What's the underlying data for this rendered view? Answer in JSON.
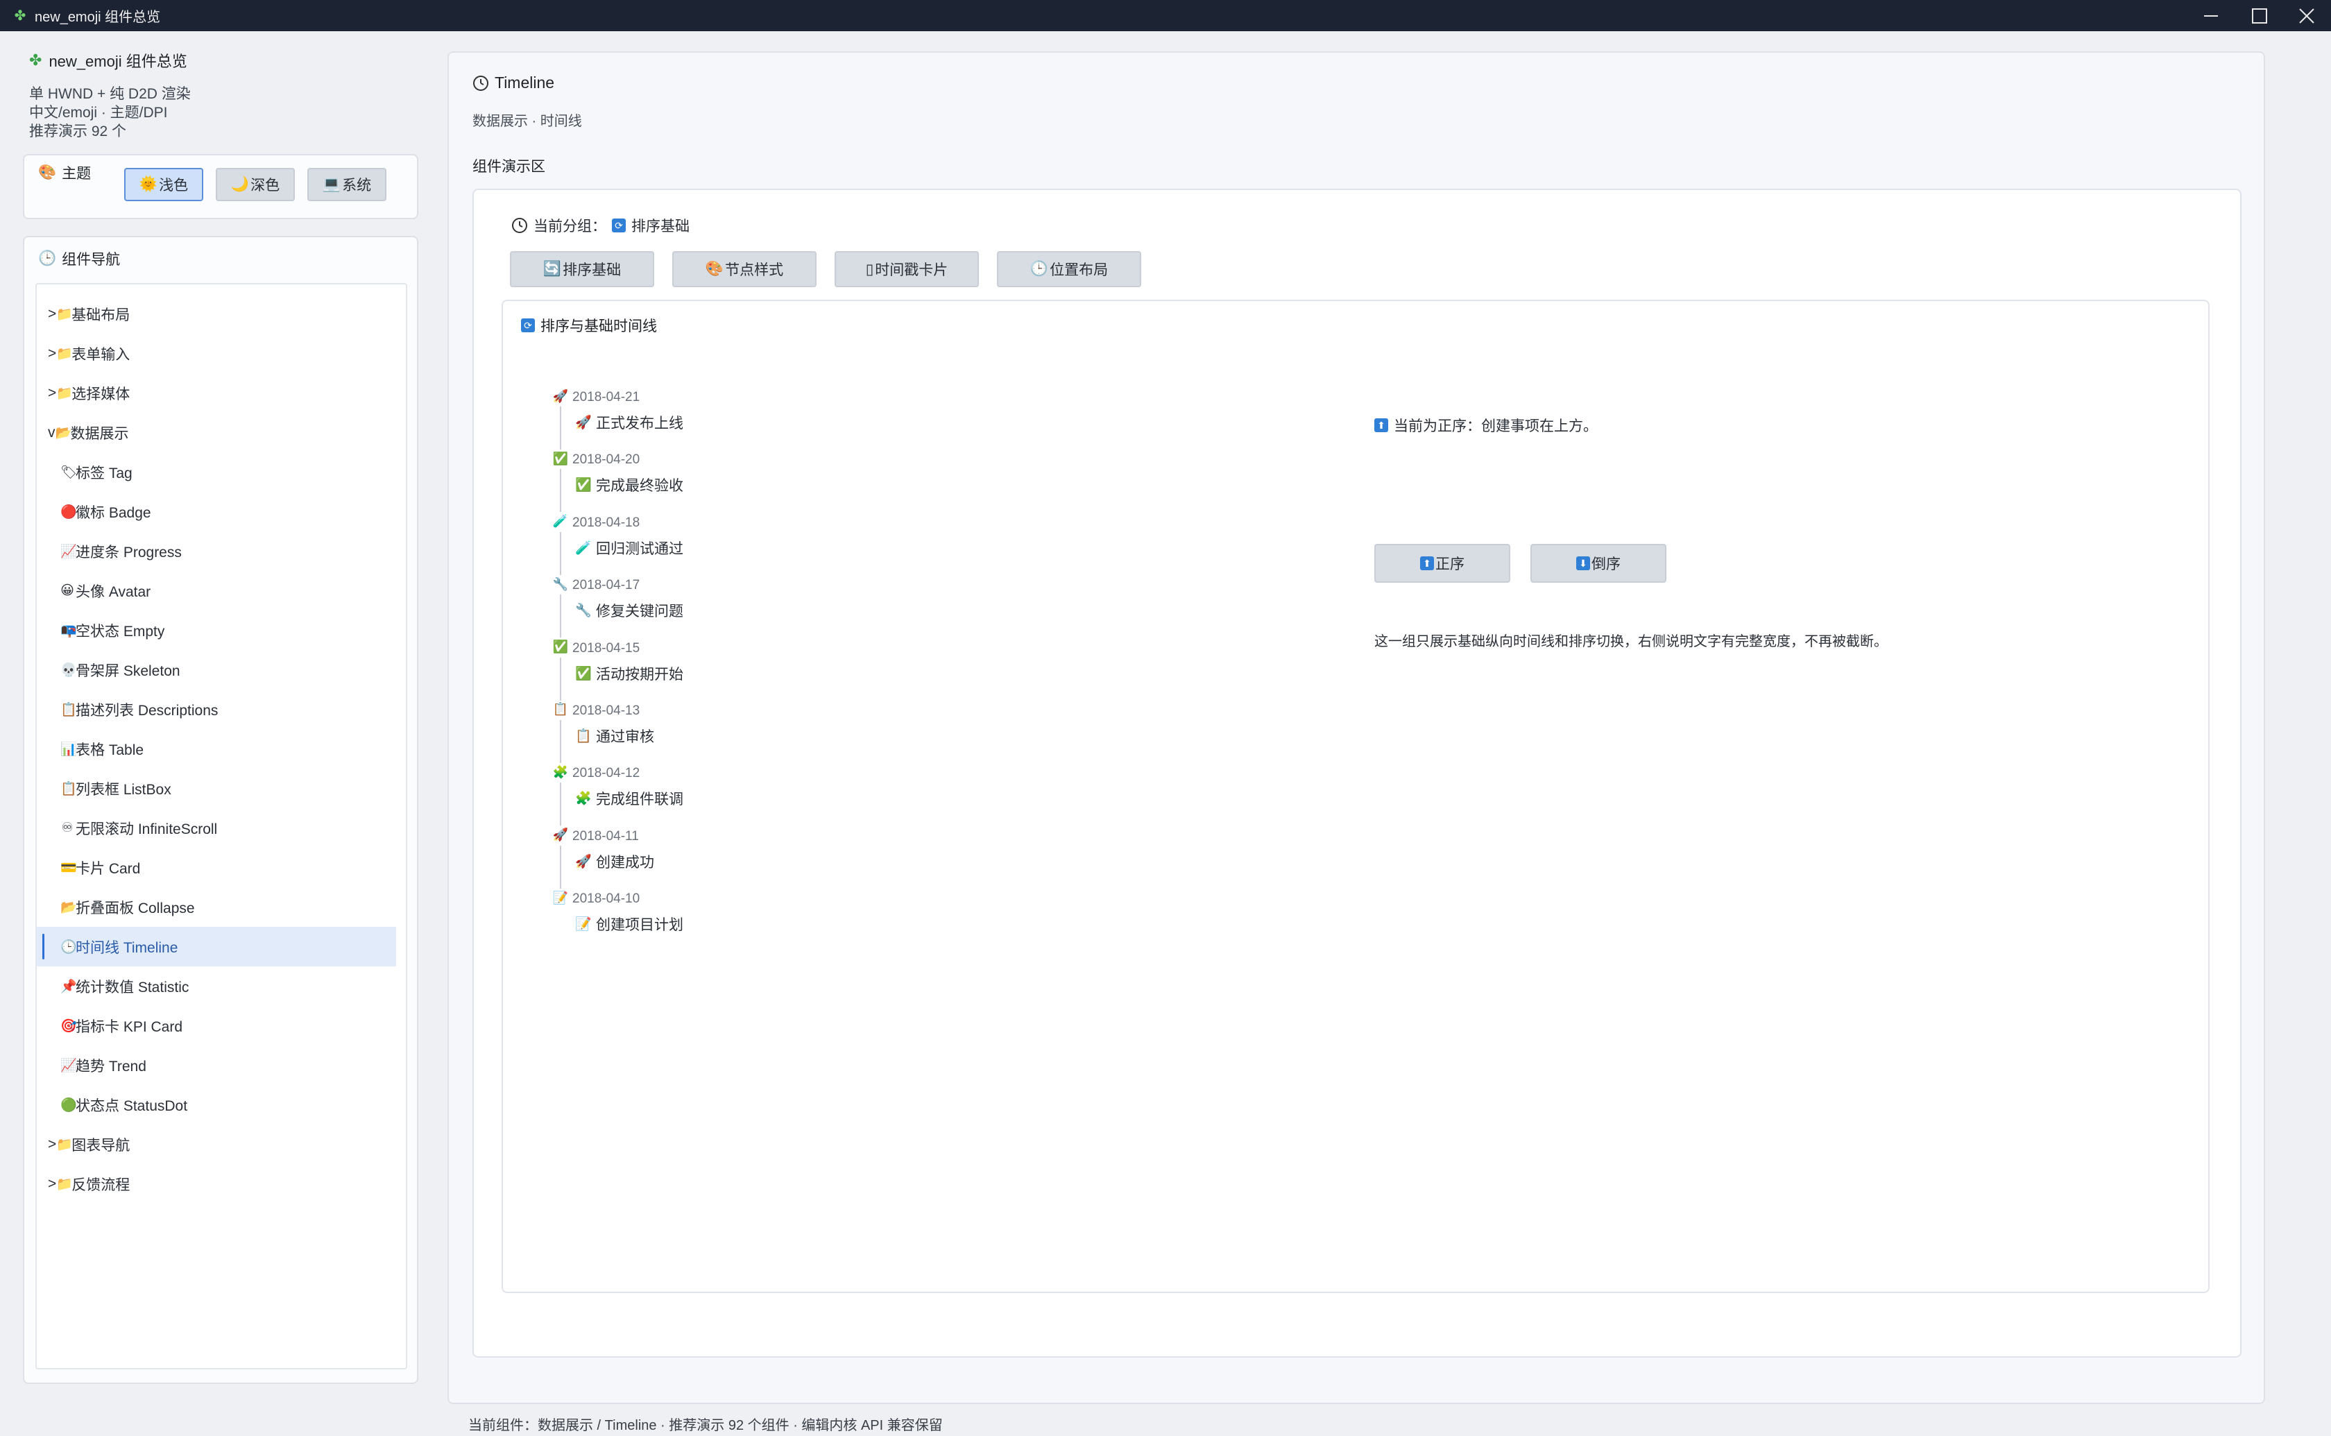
{
  "window": {
    "title": "new_emoji 组件总览"
  },
  "sidebar": {
    "app_title": "new_emoji 组件总览",
    "meta": [
      "单 HWND + 纯 D2D 渲染",
      "中文/emoji · 主题/DPI",
      "推荐演示 92 个"
    ],
    "theme": {
      "label": "主题",
      "buttons": [
        {
          "icon": "🌞",
          "label": "浅色"
        },
        {
          "icon": "🌙",
          "label": "深色"
        },
        {
          "icon": "💻",
          "label": "系统"
        }
      ]
    },
    "nav_title": "组件导航",
    "nav": [
      {
        "prefix": ">",
        "icon": "📁",
        "label": "基础布局"
      },
      {
        "prefix": ">",
        "icon": "📁",
        "label": "表单输入"
      },
      {
        "prefix": ">",
        "icon": "📁",
        "label": "选择媒体"
      },
      {
        "prefix": "v",
        "icon": "📂",
        "label": "数据展示"
      },
      {
        "icon": "🏷",
        "label": "标签 Tag"
      },
      {
        "icon": "🔴",
        "label": "徽标 Badge"
      },
      {
        "icon": "📈",
        "label": "进度条 Progress"
      },
      {
        "icon": "😀",
        "label": "头像 Avatar"
      },
      {
        "icon": "📭",
        "label": "空状态 Empty"
      },
      {
        "icon": "💀",
        "label": "骨架屏 Skeleton"
      },
      {
        "icon": "📋",
        "label": "描述列表 Descriptions"
      },
      {
        "icon": "📊",
        "label": "表格 Table"
      },
      {
        "icon": "📋",
        "label": "列表框 ListBox"
      },
      {
        "icon": "♾",
        "label": "无限滚动 InfiniteScroll"
      },
      {
        "icon": "💳",
        "label": "卡片 Card"
      },
      {
        "icon": "📂",
        "label": "折叠面板 Collapse"
      },
      {
        "icon": "🕒",
        "label": "时间线 Timeline"
      },
      {
        "icon": "📌",
        "label": "统计数值 Statistic"
      },
      {
        "icon": "🎯",
        "label": "指标卡 KPI Card"
      },
      {
        "icon": "📈",
        "label": "趋势 Trend"
      },
      {
        "icon": "🟢",
        "label": "状态点 StatusDot"
      },
      {
        "prefix": ">",
        "icon": "📁",
        "label": "图表导航"
      },
      {
        "prefix": ">",
        "icon": "📁",
        "label": "反馈流程"
      }
    ]
  },
  "main": {
    "title": "Timeline",
    "subtitle": "数据展示 · 时间线",
    "demo_label": "组件演示区",
    "current_group_label": "当前分组：",
    "current_group_value": "排序基础",
    "group_tabs": [
      {
        "icon": "🔄",
        "label": "排序基础"
      },
      {
        "icon": "🎨",
        "label": "节点样式"
      },
      {
        "icon": "▯",
        "label": "时间戳卡片"
      },
      {
        "icon": "🕒",
        "label": "位置布局"
      }
    ],
    "section_title": "排序与基础时间线",
    "timeline": [
      {
        "date": "2018-04-21",
        "icon": "🚀",
        "text": "正式发布上线",
        "icon_name": "rocket-icon"
      },
      {
        "date": "2018-04-20",
        "icon": "✅",
        "text": "完成最终验收",
        "icon_name": "check-icon"
      },
      {
        "date": "2018-04-18",
        "icon": "🧪",
        "text": "回归测试通过",
        "icon_name": "test-tube-icon"
      },
      {
        "date": "2018-04-17",
        "icon": "🔧",
        "text": "修复关键问题",
        "icon_name": "wrench-icon"
      },
      {
        "date": "2018-04-15",
        "icon": "✅",
        "text": "活动按期开始",
        "icon_name": "check-icon"
      },
      {
        "date": "2018-04-13",
        "icon": "📋",
        "text": "通过审核",
        "icon_name": "clipboard-icon"
      },
      {
        "date": "2018-04-12",
        "icon": "🧩",
        "text": "完成组件联调",
        "icon_name": "puzzle-icon"
      },
      {
        "date": "2018-04-11",
        "icon": "🚀",
        "text": "创建成功",
        "icon_name": "rocket-icon"
      },
      {
        "date": "2018-04-10",
        "icon": "📝",
        "text": "创建项目计划",
        "icon_name": "memo-icon"
      }
    ],
    "order_status": "当前为正序：创建事项在上方。",
    "order_buttons": [
      {
        "icon": "⬆",
        "label": "正序"
      },
      {
        "icon": "⬇",
        "label": "倒序"
      }
    ],
    "description": "这一组只展示基础纵向时间线和排序切换，右侧说明文字有完整宽度，不再被截断。"
  },
  "status_bar": "当前组件：数据展示 / Timeline · 推荐演示 92 个组件 · 编辑内核 API 兼容保留",
  "colors": {
    "accent": "#2f6fd6",
    "titlebar": "#1c2433",
    "selected_bg": "#e2ebf9"
  }
}
